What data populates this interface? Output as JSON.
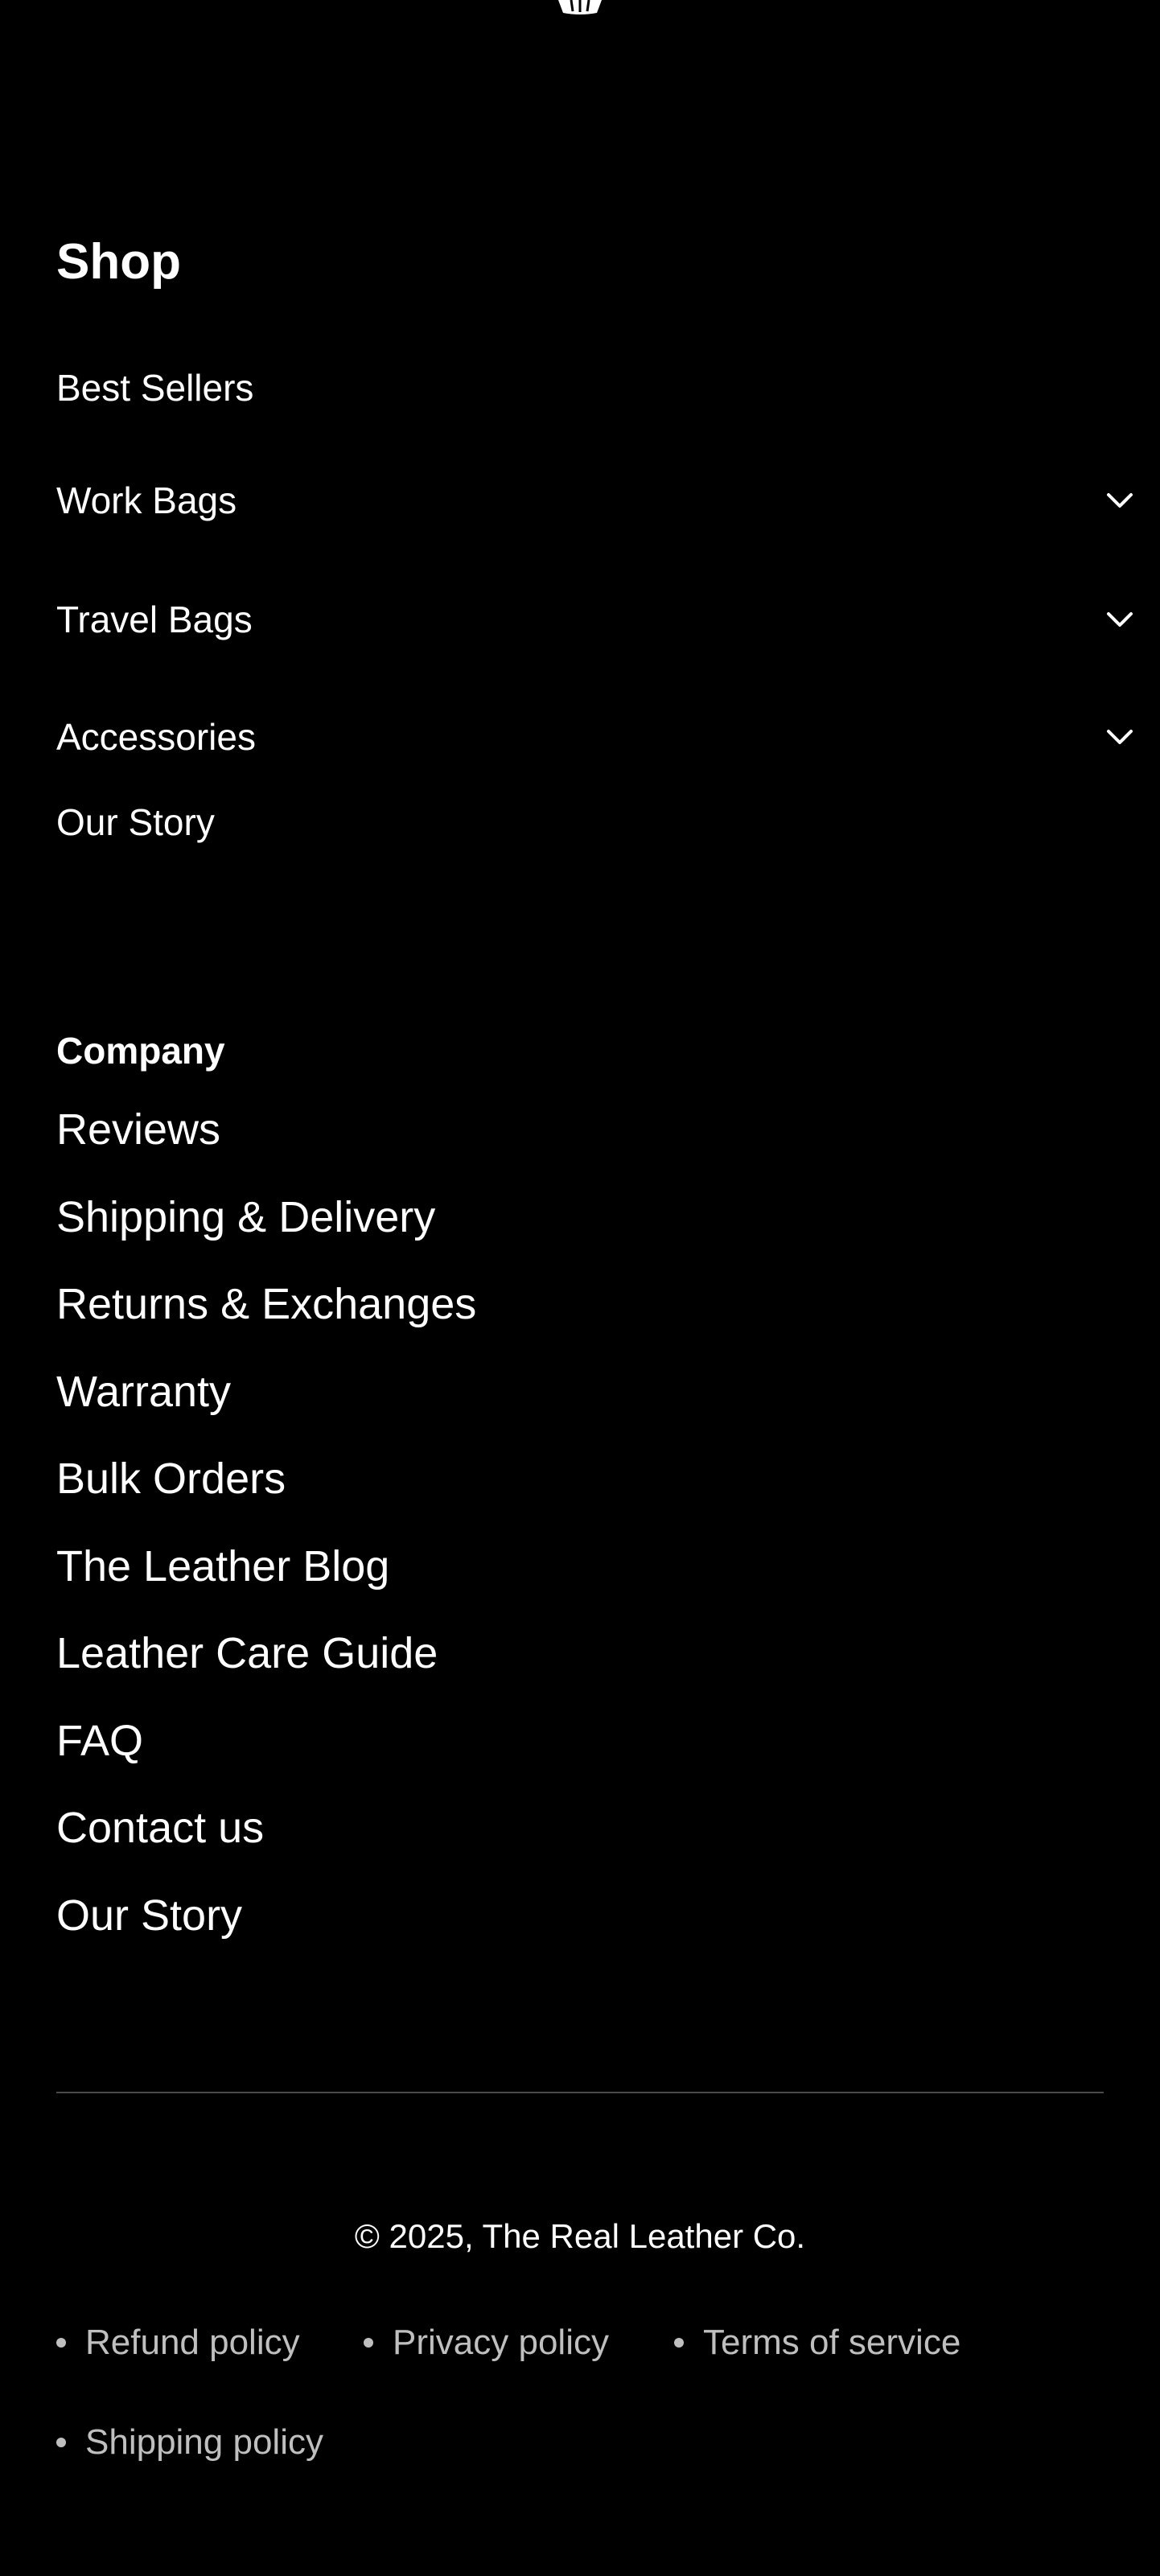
{
  "shop": {
    "heading": "Shop",
    "items": [
      {
        "label": "Best Sellers",
        "expandable": false
      },
      {
        "label": "Work Bags",
        "expandable": true
      },
      {
        "label": "Travel Bags",
        "expandable": true
      },
      {
        "label": "Accessories",
        "expandable": true
      },
      {
        "label": "Our Story",
        "expandable": false
      }
    ],
    "chevron_icon": "chevron-down-icon"
  },
  "company": {
    "heading": "Company",
    "links": [
      "Reviews",
      "Shipping & Delivery",
      "Returns & Exchanges",
      "Warranty",
      "Bulk Orders",
      "The Leather Blog",
      "Leather Care Guide",
      "FAQ",
      "Contact us",
      "Our Story"
    ]
  },
  "footer": {
    "copyright": "© 2025, The Real Leather Co.",
    "policies": [
      "Refund policy",
      "Privacy policy",
      "Terms of service",
      "Shipping policy"
    ]
  },
  "colors": {
    "background": "#000000",
    "text": "#ffffff",
    "muted_text": "#bfbfbf",
    "divider": "#4a4a4a"
  }
}
